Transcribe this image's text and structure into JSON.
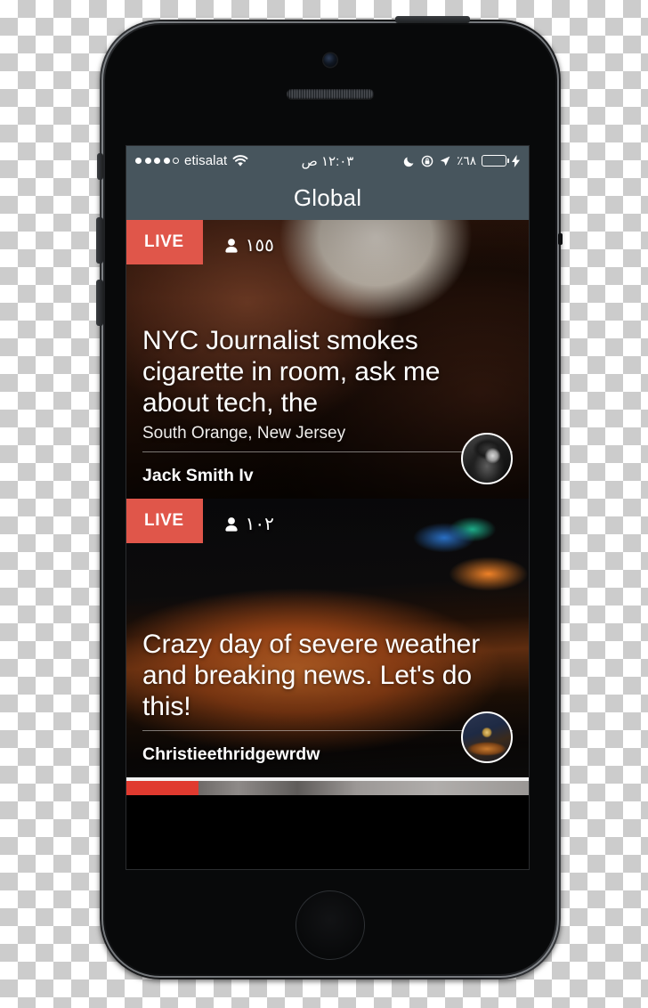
{
  "status_bar": {
    "signal_dots_filled": 4,
    "signal_dots_total": 5,
    "carrier": "etisalat",
    "wifi_icon": "wifi-icon",
    "time": "١٢:٠٣ ص",
    "moon_icon": "moon-do-not-disturb-icon",
    "rotation_lock_icon": "rotation-lock-icon",
    "location_icon": "location-arrow-icon",
    "battery_percent": "٦٨٪",
    "battery_fill_ratio": 0.68,
    "charging_icon": "lightning-bolt-icon",
    "bg_color": "#47555d",
    "battery_color": "#4ede6a"
  },
  "header": {
    "title": "Global",
    "bg_color": "#47555d"
  },
  "live_badge_color": "#e0564a",
  "cards": [
    {
      "live_label": "LIVE",
      "viewer_icon": "person-icon",
      "viewers": "١٥٥",
      "title": "NYC Journalist smokes cigarette in room, ask me about tech, the",
      "location": "South Orange, New Jersey",
      "author": "Jack Smith Iv",
      "avatar_name": "avatar-jack-smith-iv"
    },
    {
      "live_label": "LIVE",
      "viewer_icon": "person-icon",
      "viewers": "١٠٢",
      "title": "Crazy day of severe weather and breaking news. Let's do this!",
      "location": "",
      "author": "Christieethridgewrdw",
      "avatar_name": "avatar-christieethridgewrdw"
    }
  ],
  "peek_card": {
    "badge_color": "#e03a2f",
    "badge_width_percent": 18
  },
  "tab_bar": {
    "tabs": [
      {
        "name": "tv-icon",
        "label": "",
        "active": false
      },
      {
        "name": "globe-icon",
        "label": "",
        "active": true
      },
      {
        "name": "camera-icon",
        "label": "",
        "active": false
      },
      {
        "name": "people-icon",
        "label": "",
        "active": false
      }
    ],
    "bg_color": "#fdfdfd",
    "active_color": "#1b9fd0",
    "inactive_color": "#a8adb1",
    "camera_accent_color": "#e8463a"
  },
  "device": {
    "hardware": [
      "power-button",
      "mute-switch",
      "volume-up-button",
      "volume-down-button",
      "front-camera",
      "earpiece-speaker",
      "home-button"
    ]
  }
}
